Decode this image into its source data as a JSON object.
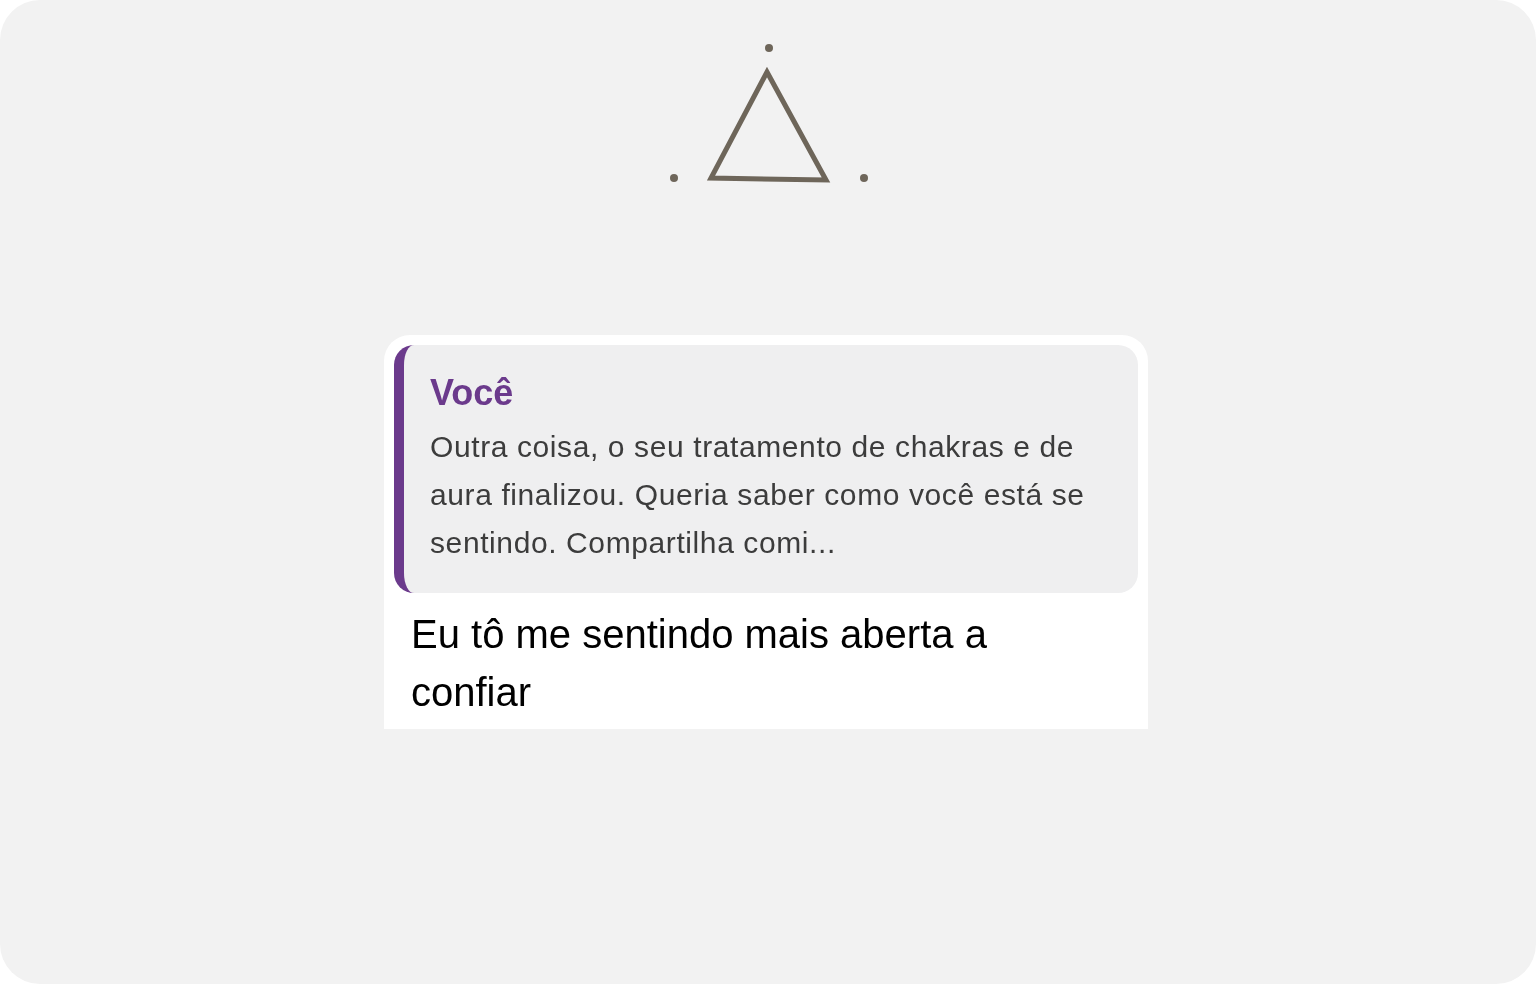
{
  "quote": {
    "author": "Você",
    "text": "Outra coisa, o seu tratamento de chakras e de aura finalizou. Queria saber como você está se sentindo. Compartilha comi..."
  },
  "reply": {
    "text": "Eu tô me sentindo mais aberta a confiar"
  }
}
